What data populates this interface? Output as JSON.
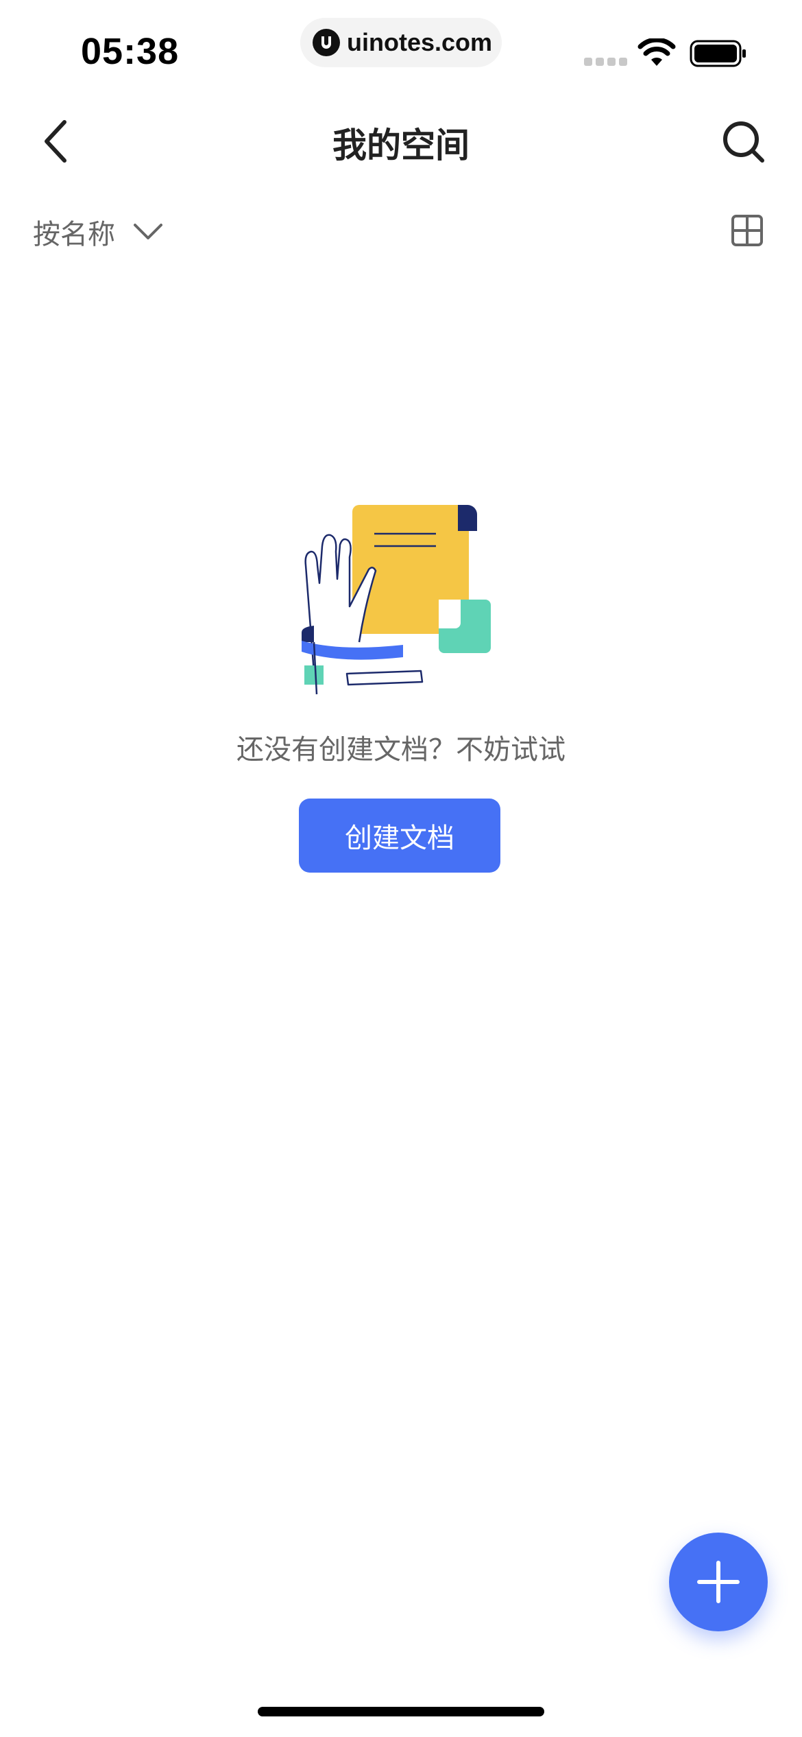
{
  "status_bar": {
    "time": "05:38",
    "url": "uinotes.com"
  },
  "nav": {
    "title": "我的空间",
    "back_icon": "chevron-left-icon",
    "search_icon": "search-icon"
  },
  "toolbar": {
    "sort_label": "按名称",
    "sort_icon": "chevron-down-icon",
    "view_toggle_icon": "grid-view-icon"
  },
  "empty_state": {
    "message": "还没有创建文档？不妨试试",
    "button_label": "创建文档",
    "illustration_icon": "document-hand-illustration"
  },
  "fab": {
    "icon": "plus-icon"
  },
  "colors": {
    "accent": "#4671f5",
    "text_secondary": "#666666",
    "illustration_yellow": "#f5c645",
    "illustration_green": "#5fd3b5",
    "illustration_navy": "#1c2a6b"
  }
}
